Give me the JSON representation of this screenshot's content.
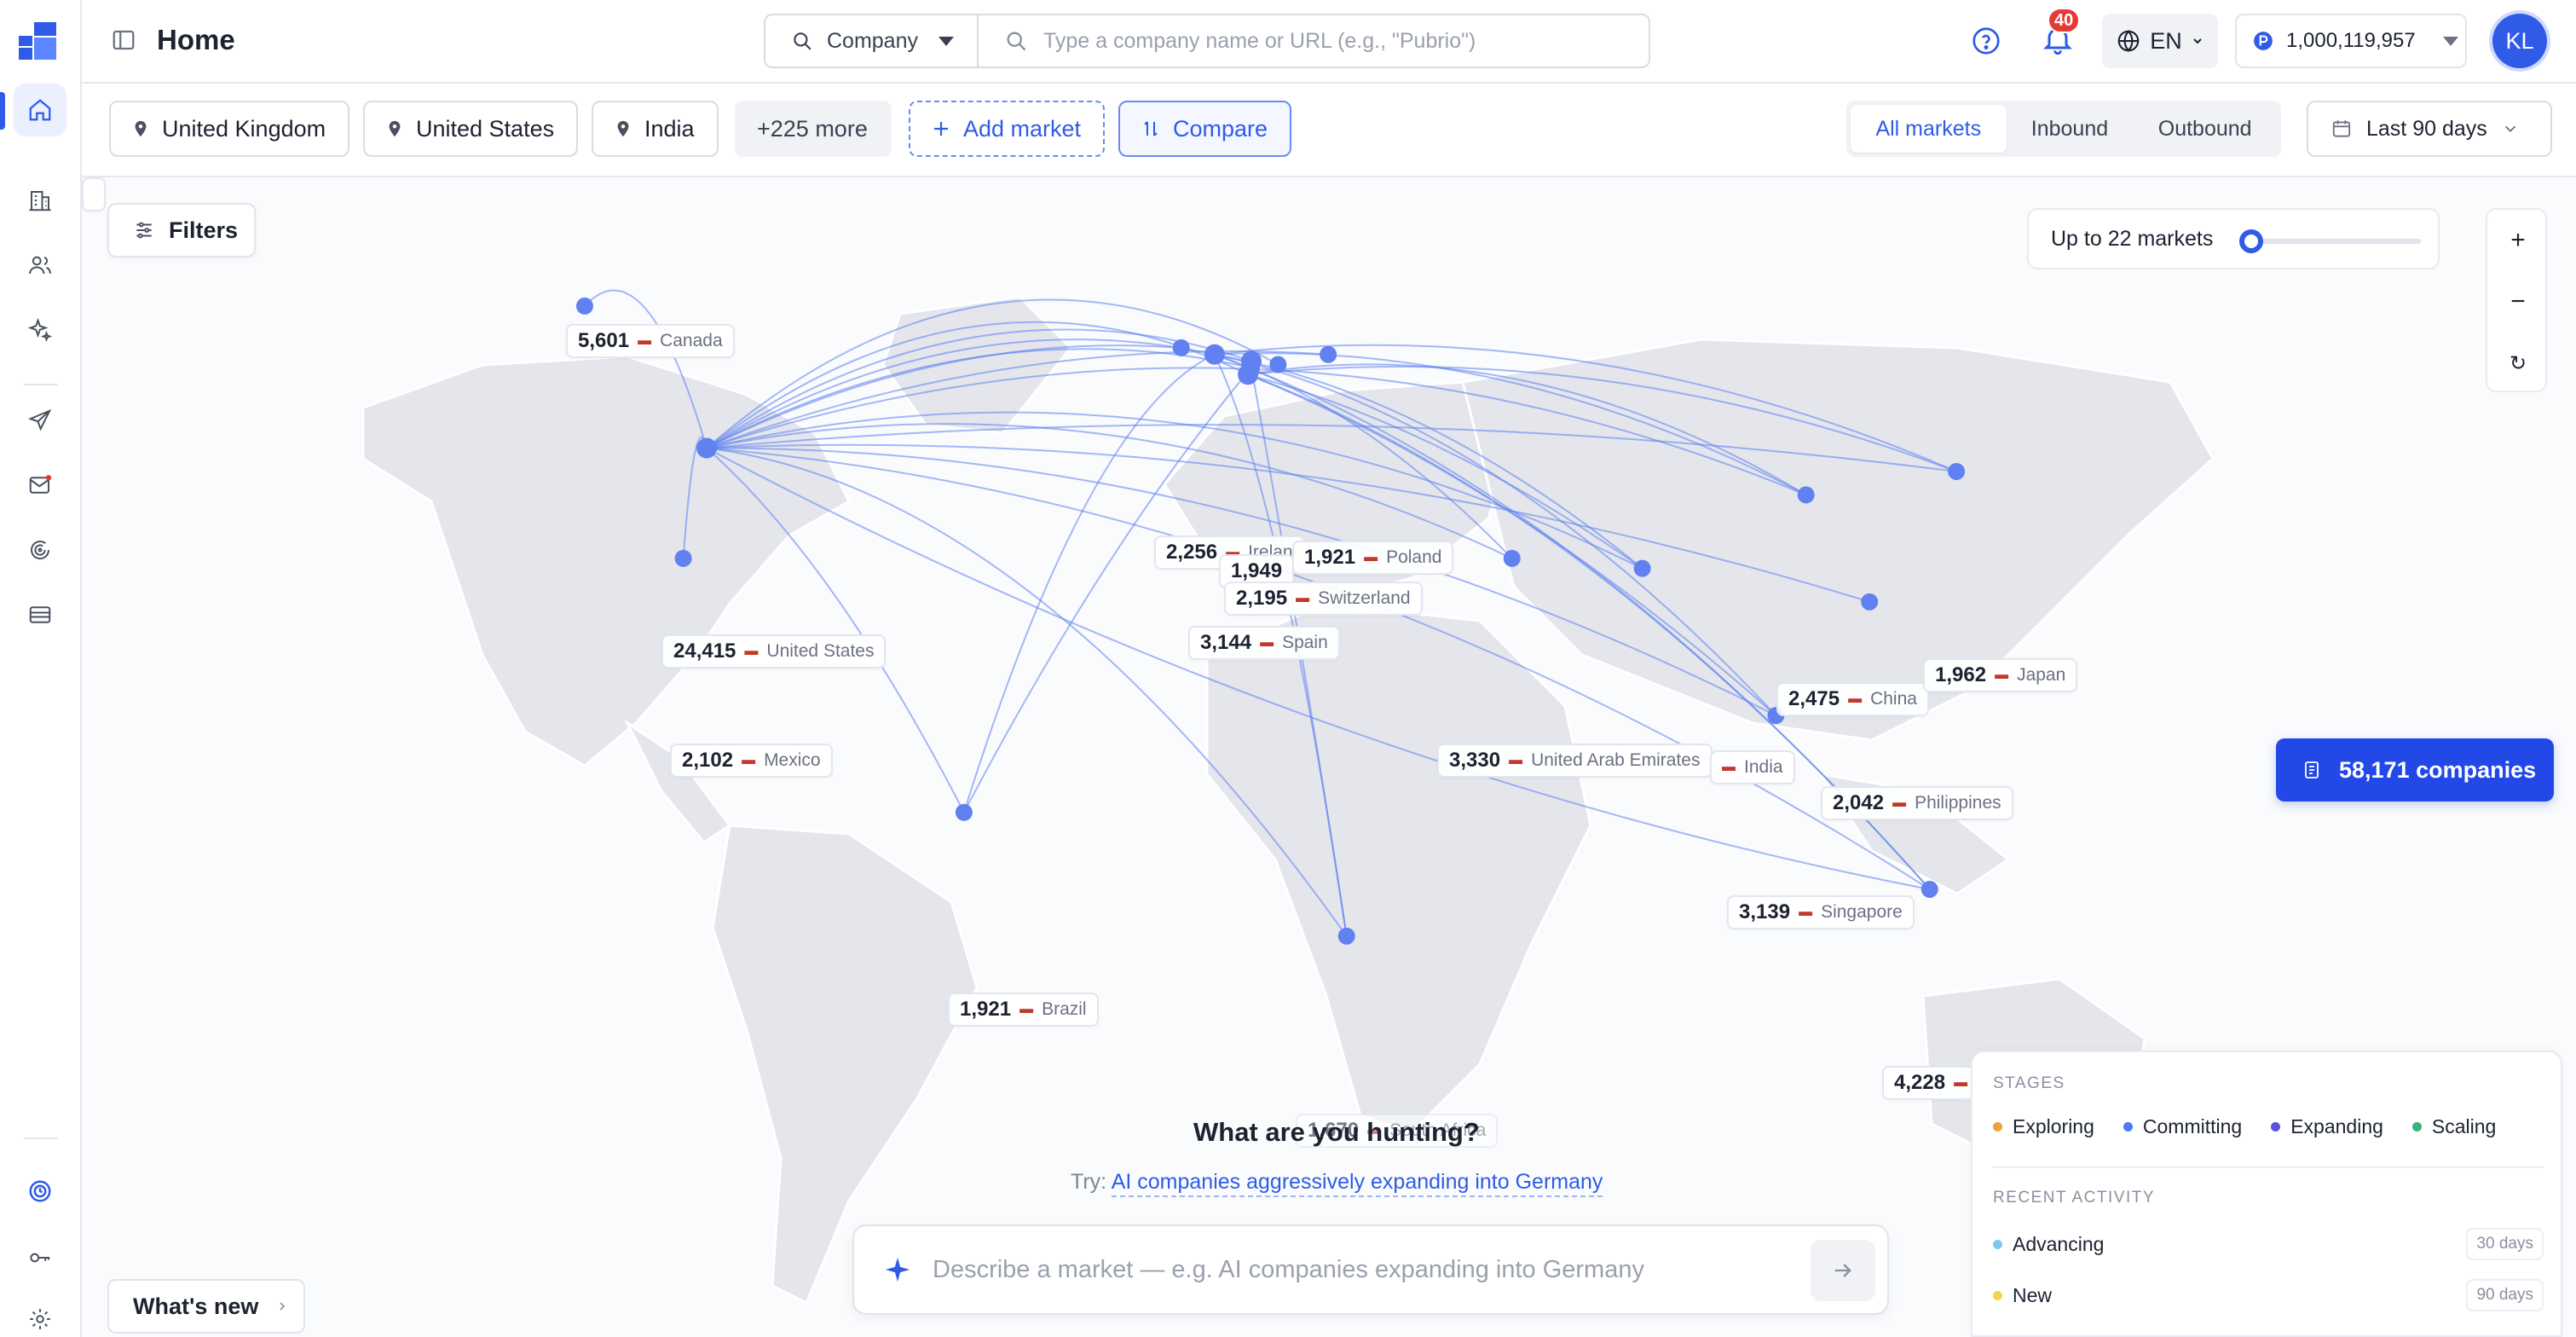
{
  "app": {
    "page_title": "Home"
  },
  "search": {
    "type_label": "Company",
    "placeholder": "Type a company name or URL (e.g., \"Pubrio\")"
  },
  "header": {
    "notifications_count": "40",
    "language": "EN",
    "credits": "1,000,119,957",
    "user_initials": "KL"
  },
  "markets": {
    "chips": [
      "United Kingdom",
      "United States",
      "India"
    ],
    "more_label": "+225 more",
    "add_label": "Add market",
    "compare_label": "Compare"
  },
  "direction_tabs": {
    "all": "All markets",
    "inbound": "Inbound",
    "outbound": "Outbound",
    "active": "all"
  },
  "date_range": "Last 90 days",
  "map": {
    "filters_label": "Filters",
    "slider_label": "Up to 22 markets",
    "slider_value_fraction": 0.05,
    "zoom_in": "+",
    "zoom_out": "−",
    "reset": "↻",
    "companies_button": "58,171 companies",
    "labels": [
      {
        "num": "5,601",
        "country": "Canada"
      },
      {
        "num": "24,415",
        "country": "United States"
      },
      {
        "num": "2,102",
        "country": "Mexico"
      },
      {
        "num": "1,921",
        "country": "Brazil"
      },
      {
        "num": "2,256",
        "country": "Irelan"
      },
      {
        "num": "1,949",
        "country": ""
      },
      {
        "num": "1,921",
        "country": "Poland"
      },
      {
        "num": "2,195",
        "country": "Switzerland"
      },
      {
        "num": "3,144",
        "country": "Spain"
      },
      {
        "num": "3,330",
        "country": "United Arab Emirates"
      },
      {
        "num": "",
        "country": "India"
      },
      {
        "num": "2,475",
        "country": "China"
      },
      {
        "num": "1,962",
        "country": "Japan"
      },
      {
        "num": "2,042",
        "country": "Philippines"
      },
      {
        "num": "3,139",
        "country": "Singapore"
      },
      {
        "num": "4,228",
        "country": ""
      },
      {
        "num": "1,670",
        "country": "South Africa"
      }
    ]
  },
  "hunt": {
    "title": "What are you hunting?",
    "try_prefix": "Try:",
    "try_link": "AI companies aggressively expanding into Germany",
    "placeholder": "Describe a market — e.g. AI companies expanding into Germany"
  },
  "whats_new": "What's new",
  "legend": {
    "stages_heading": "STAGES",
    "stages": [
      {
        "label": "Exploring",
        "color": "#f0a23a"
      },
      {
        "label": "Committing",
        "color": "#4a7cf0"
      },
      {
        "label": "Expanding",
        "color": "#5a4fe0"
      },
      {
        "label": "Scaling",
        "color": "#3bb07a"
      }
    ],
    "activity_heading": "RECENT ACTIVITY",
    "activity": [
      {
        "label": "Advancing",
        "period": "30 days",
        "color": "#7fc9ef"
      },
      {
        "label": "New",
        "period": "90 days",
        "color": "#f5d34a"
      }
    ]
  },
  "colors": {
    "accent": "#2f5be6",
    "arc": "#5b7ff0",
    "land": "#e4e6ec"
  }
}
